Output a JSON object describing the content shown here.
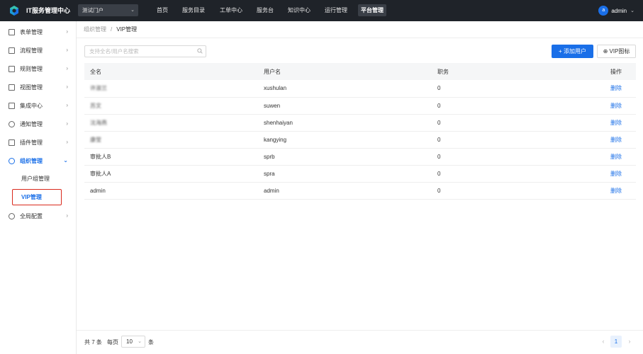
{
  "header": {
    "app_title": "IT服务管理中心",
    "portal_select": "测试门户",
    "nav": [
      "首页",
      "服务目录",
      "工单中心",
      "服务台",
      "知识中心",
      "运行管理",
      "平台管理"
    ],
    "active_nav": "平台管理",
    "user": {
      "avatar_letter": "a",
      "name": "admin"
    }
  },
  "sidebar": {
    "items": [
      {
        "label": "表单管理",
        "icon": "form-icon"
      },
      {
        "label": "流程管理",
        "icon": "flow-icon"
      },
      {
        "label": "规则管理",
        "icon": "rule-icon"
      },
      {
        "label": "视图管理",
        "icon": "view-icon"
      },
      {
        "label": "集成中心",
        "icon": "integration-icon"
      },
      {
        "label": "通知管理",
        "icon": "bell-icon"
      },
      {
        "label": "插件管理",
        "icon": "plugin-icon"
      },
      {
        "label": "组织管理",
        "icon": "org-icon"
      },
      {
        "label": "全局配置",
        "icon": "gear-icon"
      }
    ],
    "org_children": [
      "用户组管理",
      "VIP管理"
    ],
    "active_child": "VIP管理"
  },
  "breadcrumb": {
    "parent": "组织管理",
    "separator": "/",
    "current": "VIP管理"
  },
  "toolbar": {
    "search_placeholder": "支持全名/用户名搜索",
    "add_user": "+ 添加用户",
    "vip_icon": "⊕ VIP图标"
  },
  "table": {
    "columns": [
      "全名",
      "用户名",
      "职务",
      "操作"
    ],
    "rows": [
      {
        "full_name": "许淑兰",
        "username": "xushulan",
        "title": "0",
        "action": "删除",
        "blurred": true
      },
      {
        "full_name": "苏文",
        "username": "suwen",
        "title": "0",
        "action": "删除",
        "blurred": true
      },
      {
        "full_name": "沈海燕",
        "username": "shenhaiyan",
        "title": "0",
        "action": "删除",
        "blurred": true
      },
      {
        "full_name": "康莹",
        "username": "kangying",
        "title": "0",
        "action": "删除",
        "blurred": true
      },
      {
        "full_name": "审批人B",
        "username": "sprb",
        "title": "0",
        "action": "删除",
        "blurred": false
      },
      {
        "full_name": "审批人A",
        "username": "spra",
        "title": "0",
        "action": "删除",
        "blurred": false
      },
      {
        "full_name": "admin",
        "username": "admin",
        "title": "0",
        "action": "删除",
        "blurred": false
      }
    ]
  },
  "pagination": {
    "total": "共 7 条",
    "per_page_label": "每页",
    "page_size": "10",
    "unit": "条",
    "prev": "‹",
    "current_page": "1",
    "next": "›"
  },
  "colors": {
    "primary": "#1a6fe8",
    "topbar": "#1f2329",
    "highlight_box": "#d9291c"
  }
}
